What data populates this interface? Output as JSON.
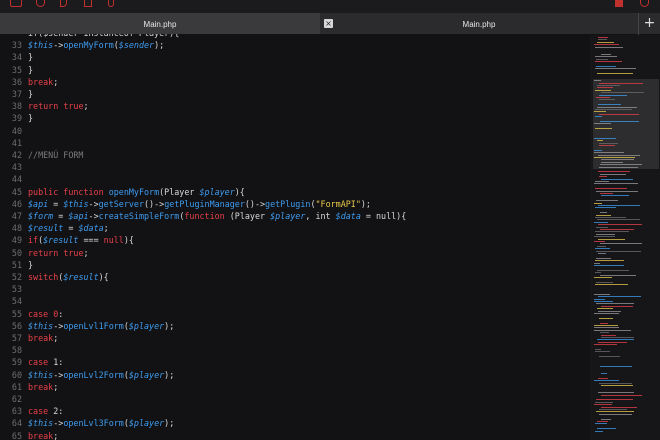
{
  "tabs": [
    {
      "label": "Main.php",
      "active": true
    },
    {
      "label": "Main.php",
      "active": false
    }
  ],
  "tab_close_glyph": "×",
  "tab_add_glyph": "+",
  "toolbar_icons": [
    "file-icon",
    "package-icon",
    "share-icon",
    "branch-icon",
    "undo-icon",
    "trash-icon",
    "settings-icon"
  ],
  "colors": {
    "keyword": "#e8404a",
    "function": "#3e9cf0",
    "string": "#eac94a",
    "comment": "#7a7a7e",
    "text": "#d9d9d9",
    "line_number": "#6e6e72"
  },
  "lines": [
    {
      "n": "",
      "segs": [
        [
          "code",
          "if($sender instanceof Player){"
        ]
      ]
    },
    {
      "n": "33",
      "segs": [
        [
          "var",
          "$this"
        ],
        [
          "code",
          "->"
        ],
        [
          "fn",
          "openMyForm"
        ],
        [
          "code",
          "("
        ],
        [
          "var",
          "$sender"
        ],
        [
          "code",
          ");"
        ]
      ]
    },
    {
      "n": "34",
      "segs": [
        [
          "code",
          "}"
        ]
      ]
    },
    {
      "n": "35",
      "segs": [
        [
          "code",
          "}"
        ]
      ]
    },
    {
      "n": "36",
      "segs": [
        [
          "kw",
          "break"
        ],
        [
          "code",
          ";"
        ]
      ]
    },
    {
      "n": "37",
      "segs": [
        [
          "code",
          "}"
        ]
      ]
    },
    {
      "n": "38",
      "segs": [
        [
          "kw",
          "return"
        ],
        [
          "code",
          " "
        ],
        [
          "kw",
          "true"
        ],
        [
          "code",
          ";"
        ]
      ]
    },
    {
      "n": "39",
      "segs": [
        [
          "code",
          "}"
        ]
      ]
    },
    {
      "n": "40",
      "segs": []
    },
    {
      "n": "41",
      "segs": []
    },
    {
      "n": "42",
      "segs": [
        [
          "cm",
          "//MENÚ FORM"
        ]
      ]
    },
    {
      "n": "43",
      "segs": []
    },
    {
      "n": "44",
      "segs": []
    },
    {
      "n": "45",
      "segs": [
        [
          "kw",
          "public function "
        ],
        [
          "fn",
          "openMyForm"
        ],
        [
          "code",
          "(Player "
        ],
        [
          "var",
          "$player"
        ],
        [
          "code",
          "){"
        ]
      ]
    },
    {
      "n": "46",
      "segs": [
        [
          "var",
          "$api"
        ],
        [
          "code",
          " = "
        ],
        [
          "var",
          "$this"
        ],
        [
          "code",
          "->"
        ],
        [
          "fn",
          "getServer"
        ],
        [
          "code",
          "()->"
        ],
        [
          "fn",
          "getPluginManager"
        ],
        [
          "code",
          "()->"
        ],
        [
          "fn",
          "getPlugin"
        ],
        [
          "code",
          "("
        ],
        [
          "str",
          "\"FormAPI\""
        ],
        [
          "code",
          ");"
        ]
      ]
    },
    {
      "n": "47",
      "segs": [
        [
          "var",
          "$form"
        ],
        [
          "code",
          " = "
        ],
        [
          "var",
          "$api"
        ],
        [
          "code",
          "->"
        ],
        [
          "fn",
          "createSimpleForm"
        ],
        [
          "code",
          "("
        ],
        [
          "kw",
          "function"
        ],
        [
          "code",
          " (Player "
        ],
        [
          "var",
          "$player"
        ],
        [
          "code",
          ", int "
        ],
        [
          "var",
          "$data"
        ],
        [
          "code",
          " = null){"
        ]
      ]
    },
    {
      "n": "48",
      "segs": [
        [
          "var",
          "$result"
        ],
        [
          "code",
          " = "
        ],
        [
          "var",
          "$data"
        ],
        [
          "code",
          ";"
        ]
      ]
    },
    {
      "n": "49",
      "segs": [
        [
          "kw",
          "if"
        ],
        [
          "code",
          "("
        ],
        [
          "var",
          "$result"
        ],
        [
          "code",
          " === "
        ],
        [
          "kw",
          "null"
        ],
        [
          "code",
          "){"
        ]
      ]
    },
    {
      "n": "50",
      "segs": [
        [
          "kw",
          "return"
        ],
        [
          "code",
          " "
        ],
        [
          "kw",
          "true"
        ],
        [
          "code",
          ";"
        ]
      ]
    },
    {
      "n": "51",
      "segs": [
        [
          "code",
          "}"
        ]
      ]
    },
    {
      "n": "52",
      "segs": [
        [
          "kw",
          "switch"
        ],
        [
          "code",
          "("
        ],
        [
          "var",
          "$result"
        ],
        [
          "code",
          "){"
        ]
      ]
    },
    {
      "n": "53",
      "segs": []
    },
    {
      "n": "54",
      "segs": []
    },
    {
      "n": "55",
      "segs": [
        [
          "kw",
          "case"
        ],
        [
          "code",
          " "
        ],
        [
          "kw",
          "0"
        ],
        [
          "code",
          ":"
        ]
      ]
    },
    {
      "n": "56",
      "segs": [
        [
          "var",
          "$this"
        ],
        [
          "code",
          "->"
        ],
        [
          "fn",
          "openLvl1Form"
        ],
        [
          "code",
          "("
        ],
        [
          "var",
          "$player"
        ],
        [
          "code",
          ");"
        ]
      ]
    },
    {
      "n": "57",
      "segs": [
        [
          "kw",
          "break"
        ],
        [
          "code",
          ";"
        ]
      ]
    },
    {
      "n": "58",
      "segs": []
    },
    {
      "n": "59",
      "segs": [
        [
          "kw",
          "case"
        ],
        [
          "code",
          " 1:"
        ]
      ]
    },
    {
      "n": "60",
      "segs": [
        [
          "var",
          "$this"
        ],
        [
          "code",
          "->"
        ],
        [
          "fn",
          "openLvl2Form"
        ],
        [
          "code",
          "("
        ],
        [
          "var",
          "$player"
        ],
        [
          "code",
          ");"
        ]
      ]
    },
    {
      "n": "61",
      "segs": [
        [
          "kw",
          "break"
        ],
        [
          "code",
          ";"
        ]
      ]
    },
    {
      "n": "62",
      "segs": []
    },
    {
      "n": "63",
      "segs": [
        [
          "kw",
          "case"
        ],
        [
          "code",
          " 2:"
        ]
      ]
    },
    {
      "n": "64",
      "segs": [
        [
          "var",
          "$this"
        ],
        [
          "code",
          "->"
        ],
        [
          "fn",
          "openLvl3Form"
        ],
        [
          "code",
          "("
        ],
        [
          "var",
          "$player"
        ],
        [
          "code",
          ");"
        ]
      ]
    },
    {
      "n": "65",
      "segs": [
        [
          "kw",
          "break"
        ],
        [
          "code",
          ";"
        ]
      ]
    }
  ]
}
